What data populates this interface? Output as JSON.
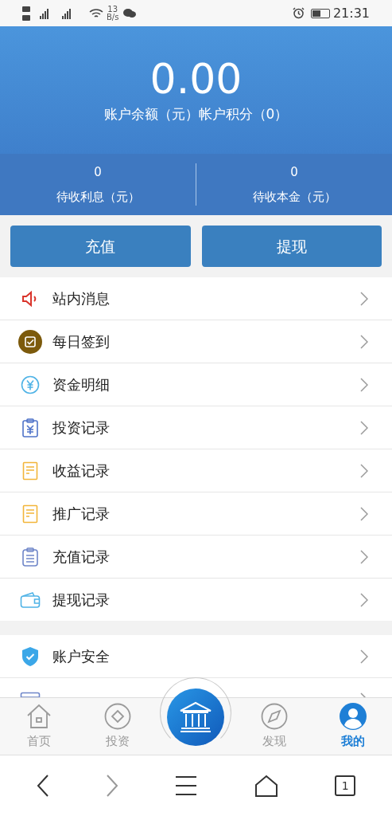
{
  "status_bar": {
    "speed_value": "13",
    "speed_unit": "B/s",
    "time": "21:31"
  },
  "balance": {
    "amount": "0.00",
    "caption": "账户余额（元）帐户积分（0）"
  },
  "pending": [
    {
      "value": "0",
      "label": "待收利息（元）"
    },
    {
      "value": "0",
      "label": "待收本金（元）"
    }
  ],
  "actions": [
    "充值",
    "提现"
  ],
  "menu_groups": [
    {
      "items": [
        {
          "label": "站内消息",
          "kind": "speaker"
        },
        {
          "label": "每日签到",
          "kind": "checkin"
        },
        {
          "label": "资金明细",
          "kind": "yen"
        },
        {
          "label": "投资记录",
          "kind": "clipboard-yen"
        },
        {
          "label": "收益记录",
          "kind": "note"
        },
        {
          "label": "推广记录",
          "kind": "note"
        },
        {
          "label": "充值记录",
          "kind": "clipboard"
        },
        {
          "label": "提现记录",
          "kind": "wallet"
        }
      ]
    },
    {
      "items": [
        {
          "label": "账户安全",
          "kind": "shield"
        },
        {
          "kind": "card"
        }
      ]
    }
  ],
  "tab_bar": [
    {
      "label": "首页",
      "kind": "home",
      "selected": false
    },
    {
      "label": "投资",
      "kind": "invest",
      "selected": false
    },
    {
      "kind": "center",
      "selected": false
    },
    {
      "label": "发现",
      "kind": "compass",
      "selected": false
    },
    {
      "label": "我的",
      "kind": "user",
      "selected": true
    }
  ],
  "system_nav": {
    "tab_count": "1"
  }
}
